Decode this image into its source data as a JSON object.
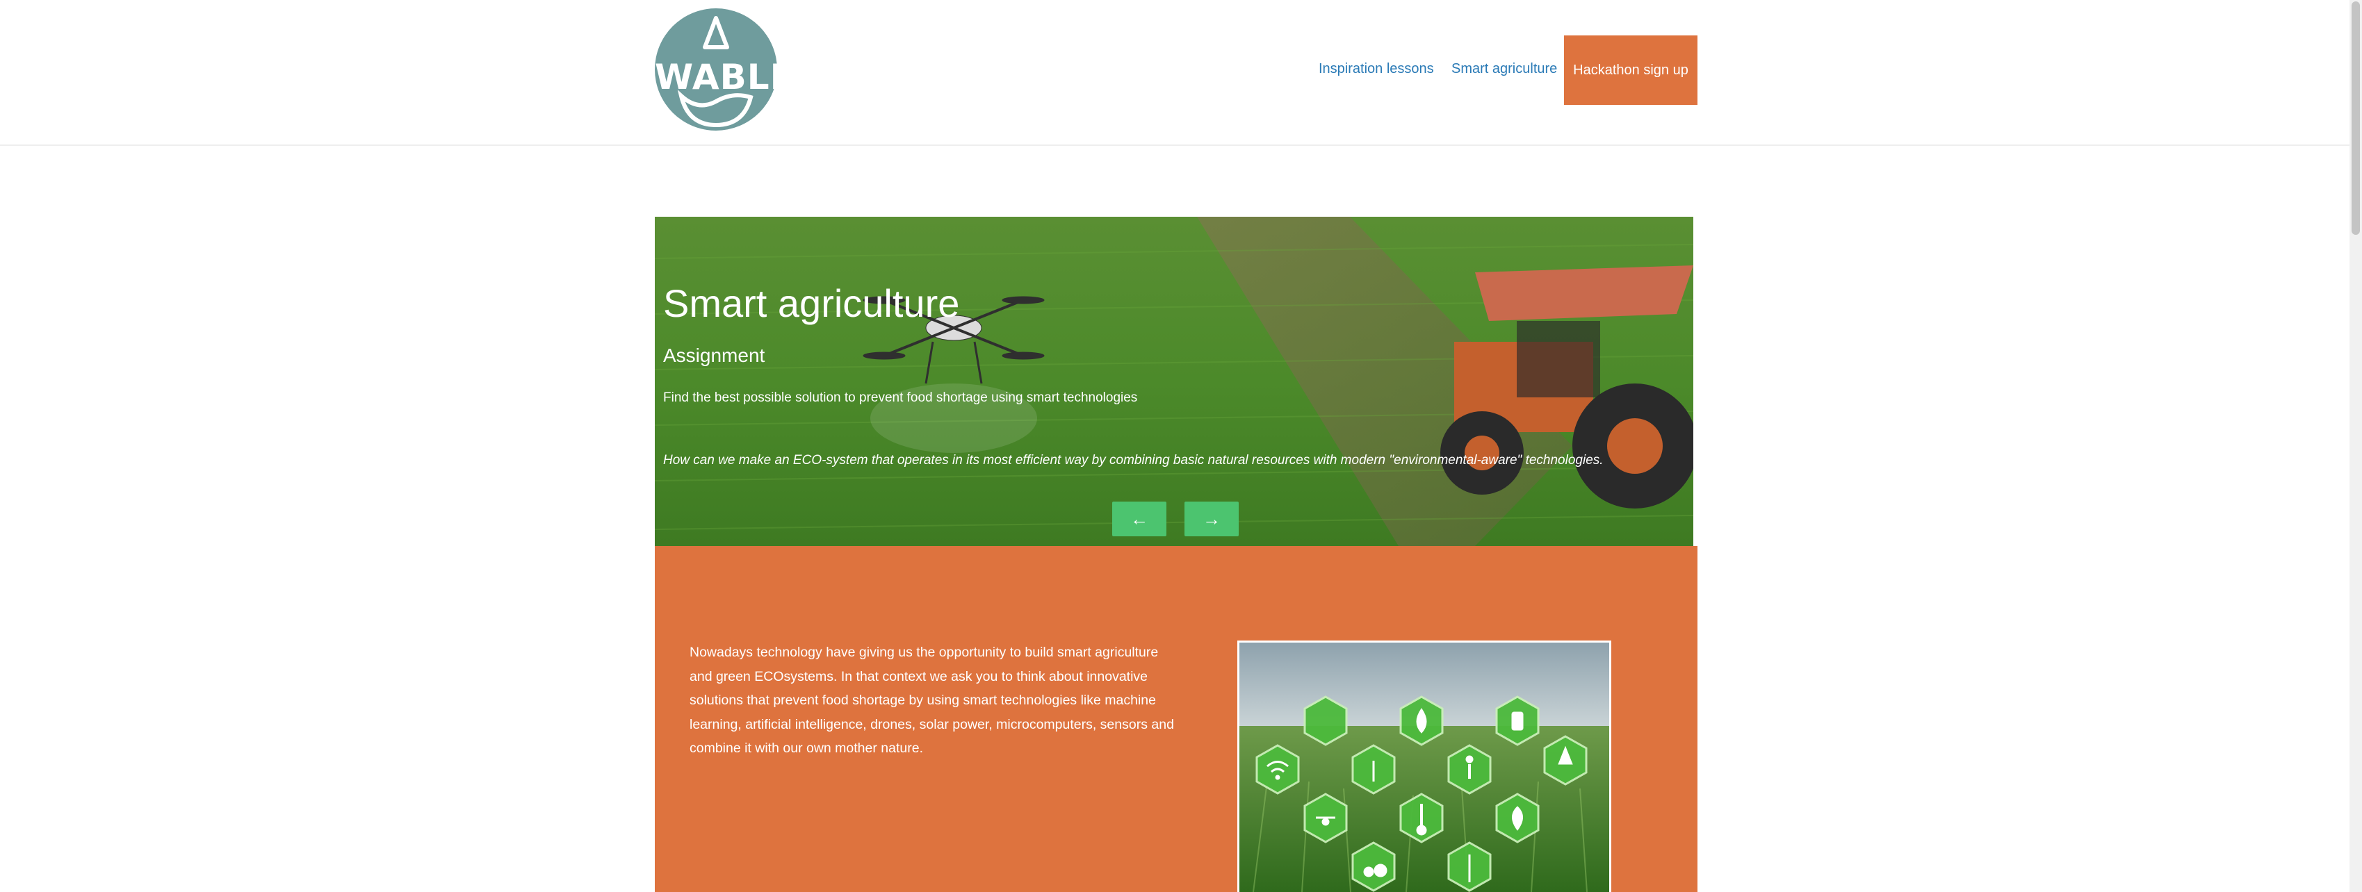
{
  "logo": {
    "text": "WABLE"
  },
  "nav": {
    "links": [
      "Inspiration lessons",
      "Smart agriculture"
    ],
    "signup_label": "Hackathon sign up"
  },
  "hero": {
    "title": "Smart agriculture",
    "subtitle": "Assignment",
    "description": "Find the best possible solution to prevent food shortage using smart technologies",
    "quote": "How can we make an ECO-system that operates in its most efficient way by combining basic natural resources with modern \"environmental-aware\" technologies.",
    "prev_label": "←",
    "next_label": "→"
  },
  "section": {
    "paragraph": "Nowadays technology have giving us the opportunity to build smart agriculture and green ECOsystems. In that context we ask you to think about innovative solutions that prevent food shortage by using smart technologies like machine learning, artificial intelligence, drones, solar power, microcomputers, sensors and combine it with our own mother nature."
  },
  "colors": {
    "accent": "#de733e",
    "link": "#2a7ab6",
    "slider_button": "#4cc46f",
    "logo_bg": "#6f9c9d"
  }
}
